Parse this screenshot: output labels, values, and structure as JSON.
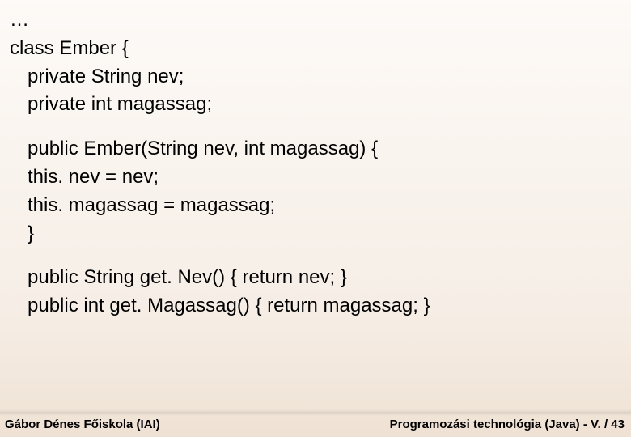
{
  "code": {
    "l0": "…",
    "l1": "class Ember {",
    "l2": "private String nev;",
    "l3": "private int magassag;",
    "l4": "public Ember(String nev, int magassag) {",
    "l5": "this. nev = nev;",
    "l6": "this. magassag = magassag;",
    "l7": "}",
    "l8": "public String get. Nev() { return nev; }",
    "l9": "public int get. Magassag() { return magassag; }"
  },
  "footer": {
    "left": "Gábor Dénes Főiskola (IAI)",
    "right": "Programozási technológia (Java)  -  V. / 43"
  }
}
